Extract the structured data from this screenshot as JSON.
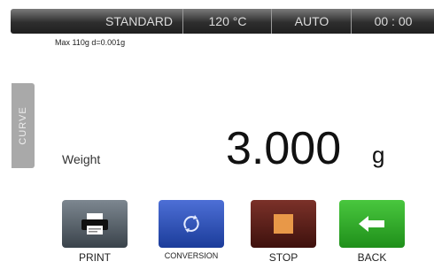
{
  "status_bar": {
    "mode": "STANDARD",
    "temperature": "120 °C",
    "auto": "AUTO",
    "time": "00 : 00"
  },
  "spec_text": "Max 110g  d=0.001g",
  "side_tab": "CURVE",
  "weight": {
    "label": "Weight",
    "value": "3.000",
    "unit": "g"
  },
  "buttons": {
    "print": "PRINT",
    "conversion": "CONVERSION",
    "stop": "STOP",
    "back": "BACK"
  },
  "icons": {
    "print": "printer-icon",
    "conversion": "cycle-icon",
    "stop": "stop-square-icon",
    "back": "left-arrow-icon"
  },
  "colors": {
    "print": "#4f5962",
    "conversion": "#2a4fb8",
    "stop": "#5a1e18",
    "back": "#2fab2a"
  }
}
